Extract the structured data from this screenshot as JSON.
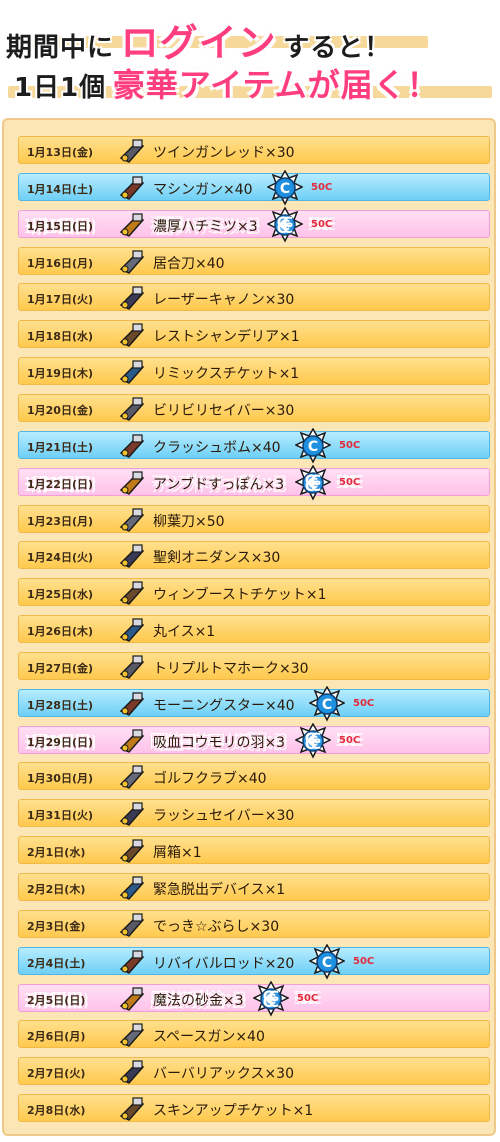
{
  "header": {
    "line1": {
      "a": "期間中に",
      "b": "ログイン",
      "c": "すると！"
    },
    "line2": {
      "a": "1日1個",
      "b": "豪華アイテムが届く！"
    }
  },
  "rows": [
    {
      "date": "1月13日(金)",
      "item": "ツインガンレッド×30",
      "type": "gold",
      "coin": "",
      "icon": "twin-gun-red-icon"
    },
    {
      "date": "1月14日(土)",
      "item": "マシンガン×40",
      "type": "blue",
      "coin": "50C",
      "icon": "machine-gun-icon"
    },
    {
      "date": "1月15日(日)",
      "item": "濃厚ハチミツ×3",
      "type": "pink",
      "coin": "50C",
      "icon": "honey-icon"
    },
    {
      "date": "1月16日(月)",
      "item": "居合刀×40",
      "type": "gold",
      "coin": "",
      "icon": "iai-blade-icon"
    },
    {
      "date": "1月17日(火)",
      "item": "レーザーキャノン×30",
      "type": "gold",
      "coin": "",
      "icon": "laser-cannon-icon"
    },
    {
      "date": "1月18日(水)",
      "item": "レストシャンデリア×1",
      "type": "gold",
      "coin": "",
      "icon": "chandelier-icon"
    },
    {
      "date": "1月19日(木)",
      "item": "リミックスチケット×1",
      "type": "gold",
      "coin": "",
      "icon": "remix-ticket-icon"
    },
    {
      "date": "1月20日(金)",
      "item": "ビリビリセイバー×30",
      "type": "gold",
      "coin": "",
      "icon": "biribiri-saber-icon"
    },
    {
      "date": "1月21日(土)",
      "item": "クラッシュボム×40",
      "type": "blue",
      "coin": "50C",
      "icon": "crash-bomb-icon"
    },
    {
      "date": "1月22日(日)",
      "item": "アンブドすっぽん×3",
      "type": "pink",
      "coin": "50C",
      "icon": "turtle-icon"
    },
    {
      "date": "1月23日(月)",
      "item": "柳葉刀×50",
      "type": "gold",
      "coin": "",
      "icon": "willow-blade-icon"
    },
    {
      "date": "1月24日(火)",
      "item": "聖剣オニダンス×30",
      "type": "gold",
      "coin": "",
      "icon": "holy-sword-icon"
    },
    {
      "date": "1月25日(水)",
      "item": "ウィンブーストチケット×1",
      "type": "gold",
      "coin": "",
      "icon": "win-boost-ticket-icon"
    },
    {
      "date": "1月26日(木)",
      "item": "丸イス×1",
      "type": "gold",
      "coin": "",
      "icon": "round-stool-icon"
    },
    {
      "date": "1月27日(金)",
      "item": "トリプルトマホーク×30",
      "type": "gold",
      "coin": "",
      "icon": "tomahawk-icon"
    },
    {
      "date": "1月28日(土)",
      "item": "モーニングスター×40",
      "type": "blue",
      "coin": "50C",
      "icon": "morning-star-icon"
    },
    {
      "date": "1月29日(日)",
      "item": "吸血コウモリの羽×3",
      "type": "pink",
      "coin": "50C",
      "icon": "bat-wing-icon"
    },
    {
      "date": "1月30日(月)",
      "item": "ゴルフクラブ×40",
      "type": "gold",
      "coin": "",
      "icon": "golf-club-icon"
    },
    {
      "date": "1月31日(火)",
      "item": "ラッシュセイバー×30",
      "type": "gold",
      "coin": "",
      "icon": "rush-saber-icon"
    },
    {
      "date": "2月1日(水)",
      "item": "屑箱×1",
      "type": "gold",
      "coin": "",
      "icon": "trash-can-icon"
    },
    {
      "date": "2月2日(木)",
      "item": "緊急脱出デバイス×1",
      "type": "gold",
      "coin": "",
      "icon": "escape-device-icon"
    },
    {
      "date": "2月3日(金)",
      "item": "でっき☆ぶらし×30",
      "type": "gold",
      "coin": "",
      "icon": "deck-brush-icon"
    },
    {
      "date": "2月4日(土)",
      "item": "リバイバルロッド×20",
      "type": "blue",
      "coin": "50C",
      "icon": "revival-rod-icon"
    },
    {
      "date": "2月5日(日)",
      "item": "魔法の砂金×3",
      "type": "pink",
      "coin": "50C",
      "icon": "gold-dust-icon"
    },
    {
      "date": "2月6日(月)",
      "item": "スペースガン×40",
      "type": "gold",
      "coin": "",
      "icon": "space-gun-icon"
    },
    {
      "date": "2月7日(火)",
      "item": "バーバリアックス×30",
      "type": "gold",
      "coin": "",
      "icon": "barbarian-axe-icon"
    },
    {
      "date": "2月8日(水)",
      "item": "スキンアップチケット×1",
      "type": "gold",
      "coin": "",
      "icon": "skin-up-ticket-icon"
    }
  ]
}
